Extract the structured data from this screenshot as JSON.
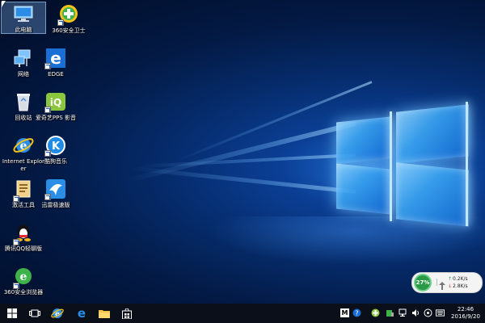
{
  "desktop": {
    "icons": [
      {
        "label": "此电脑",
        "icon": "this-pc-icon"
      },
      {
        "label": "360安全卫士",
        "icon": "360-safe-icon"
      },
      {
        "label": "网络",
        "icon": "network-icon"
      },
      {
        "label": "EDGE",
        "icon": "edge-icon"
      },
      {
        "label": "回收站",
        "icon": "recycle-bin-icon"
      },
      {
        "label": "爱奇艺PPS 影音",
        "icon": "iqiyi-icon"
      },
      {
        "label": "Internet Explorer",
        "icon": "ie-icon"
      },
      {
        "label": "酷狗音乐",
        "icon": "kugou-icon"
      },
      {
        "label": "激活工具",
        "icon": "activation-tool-icon"
      },
      {
        "label": "迅雷极速版",
        "icon": "xunlei-icon"
      },
      {
        "label": "腾讯QQ轻聊版",
        "icon": "qq-icon"
      },
      {
        "label": "360安全浏览器",
        "icon": "360-browser-icon"
      }
    ]
  },
  "net_widget": {
    "percent": "27%",
    "upload": "0.2K/s",
    "download": "2.8K/s"
  },
  "taskbar": {
    "pinned": [
      "start-icon",
      "task-view-icon",
      "ie-icon",
      "edge-icon",
      "file-explorer-icon",
      "store-icon"
    ],
    "clock_time": "22:46",
    "clock_date": "2016/9/20",
    "tray_badge": "M"
  },
  "colors": {
    "accent": "#1a6fd6",
    "taskbar": "#0a0f1a"
  }
}
